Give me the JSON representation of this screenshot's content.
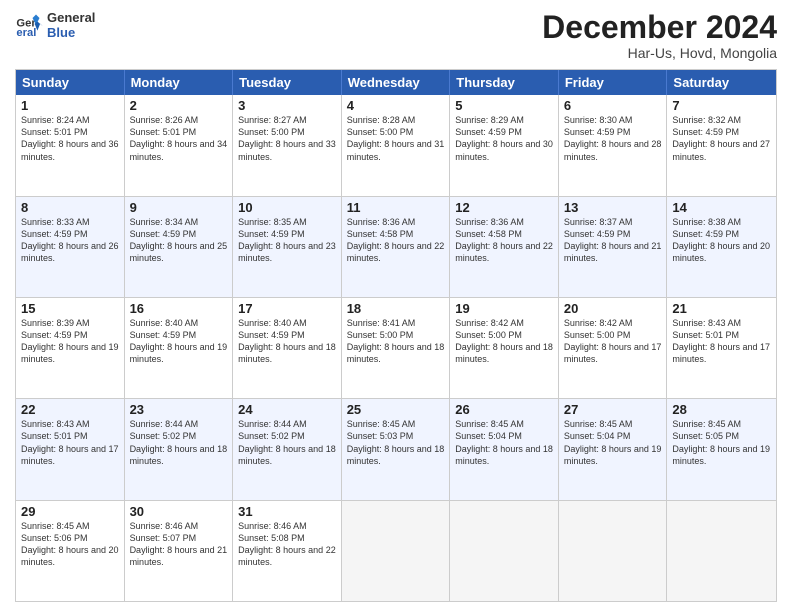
{
  "logo": {
    "line1": "General",
    "line2": "Blue"
  },
  "title": "December 2024",
  "location": "Har-Us, Hovd, Mongolia",
  "days_of_week": [
    "Sunday",
    "Monday",
    "Tuesday",
    "Wednesday",
    "Thursday",
    "Friday",
    "Saturday"
  ],
  "weeks": [
    [
      {
        "day": "1",
        "sunrise": "8:24 AM",
        "sunset": "5:01 PM",
        "daylight": "8 hours and 36 minutes."
      },
      {
        "day": "2",
        "sunrise": "8:26 AM",
        "sunset": "5:01 PM",
        "daylight": "8 hours and 34 minutes."
      },
      {
        "day": "3",
        "sunrise": "8:27 AM",
        "sunset": "5:00 PM",
        "daylight": "8 hours and 33 minutes."
      },
      {
        "day": "4",
        "sunrise": "8:28 AM",
        "sunset": "5:00 PM",
        "daylight": "8 hours and 31 minutes."
      },
      {
        "day": "5",
        "sunrise": "8:29 AM",
        "sunset": "4:59 PM",
        "daylight": "8 hours and 30 minutes."
      },
      {
        "day": "6",
        "sunrise": "8:30 AM",
        "sunset": "4:59 PM",
        "daylight": "8 hours and 28 minutes."
      },
      {
        "day": "7",
        "sunrise": "8:32 AM",
        "sunset": "4:59 PM",
        "daylight": "8 hours and 27 minutes."
      }
    ],
    [
      {
        "day": "8",
        "sunrise": "8:33 AM",
        "sunset": "4:59 PM",
        "daylight": "8 hours and 26 minutes."
      },
      {
        "day": "9",
        "sunrise": "8:34 AM",
        "sunset": "4:59 PM",
        "daylight": "8 hours and 25 minutes."
      },
      {
        "day": "10",
        "sunrise": "8:35 AM",
        "sunset": "4:59 PM",
        "daylight": "8 hours and 23 minutes."
      },
      {
        "day": "11",
        "sunrise": "8:36 AM",
        "sunset": "4:58 PM",
        "daylight": "8 hours and 22 minutes."
      },
      {
        "day": "12",
        "sunrise": "8:36 AM",
        "sunset": "4:58 PM",
        "daylight": "8 hours and 22 minutes."
      },
      {
        "day": "13",
        "sunrise": "8:37 AM",
        "sunset": "4:59 PM",
        "daylight": "8 hours and 21 minutes."
      },
      {
        "day": "14",
        "sunrise": "8:38 AM",
        "sunset": "4:59 PM",
        "daylight": "8 hours and 20 minutes."
      }
    ],
    [
      {
        "day": "15",
        "sunrise": "8:39 AM",
        "sunset": "4:59 PM",
        "daylight": "8 hours and 19 minutes."
      },
      {
        "day": "16",
        "sunrise": "8:40 AM",
        "sunset": "4:59 PM",
        "daylight": "8 hours and 19 minutes."
      },
      {
        "day": "17",
        "sunrise": "8:40 AM",
        "sunset": "4:59 PM",
        "daylight": "8 hours and 18 minutes."
      },
      {
        "day": "18",
        "sunrise": "8:41 AM",
        "sunset": "5:00 PM",
        "daylight": "8 hours and 18 minutes."
      },
      {
        "day": "19",
        "sunrise": "8:42 AM",
        "sunset": "5:00 PM",
        "daylight": "8 hours and 18 minutes."
      },
      {
        "day": "20",
        "sunrise": "8:42 AM",
        "sunset": "5:00 PM",
        "daylight": "8 hours and 17 minutes."
      },
      {
        "day": "21",
        "sunrise": "8:43 AM",
        "sunset": "5:01 PM",
        "daylight": "8 hours and 17 minutes."
      }
    ],
    [
      {
        "day": "22",
        "sunrise": "8:43 AM",
        "sunset": "5:01 PM",
        "daylight": "8 hours and 17 minutes."
      },
      {
        "day": "23",
        "sunrise": "8:44 AM",
        "sunset": "5:02 PM",
        "daylight": "8 hours and 18 minutes."
      },
      {
        "day": "24",
        "sunrise": "8:44 AM",
        "sunset": "5:02 PM",
        "daylight": "8 hours and 18 minutes."
      },
      {
        "day": "25",
        "sunrise": "8:45 AM",
        "sunset": "5:03 PM",
        "daylight": "8 hours and 18 minutes."
      },
      {
        "day": "26",
        "sunrise": "8:45 AM",
        "sunset": "5:04 PM",
        "daylight": "8 hours and 18 minutes."
      },
      {
        "day": "27",
        "sunrise": "8:45 AM",
        "sunset": "5:04 PM",
        "daylight": "8 hours and 19 minutes."
      },
      {
        "day": "28",
        "sunrise": "8:45 AM",
        "sunset": "5:05 PM",
        "daylight": "8 hours and 19 minutes."
      }
    ],
    [
      {
        "day": "29",
        "sunrise": "8:45 AM",
        "sunset": "5:06 PM",
        "daylight": "8 hours and 20 minutes."
      },
      {
        "day": "30",
        "sunrise": "8:46 AM",
        "sunset": "5:07 PM",
        "daylight": "8 hours and 21 minutes."
      },
      {
        "day": "31",
        "sunrise": "8:46 AM",
        "sunset": "5:08 PM",
        "daylight": "8 hours and 22 minutes."
      },
      null,
      null,
      null,
      null
    ]
  ],
  "labels": {
    "sunrise": "Sunrise:",
    "sunset": "Sunset:",
    "daylight": "Daylight:"
  }
}
